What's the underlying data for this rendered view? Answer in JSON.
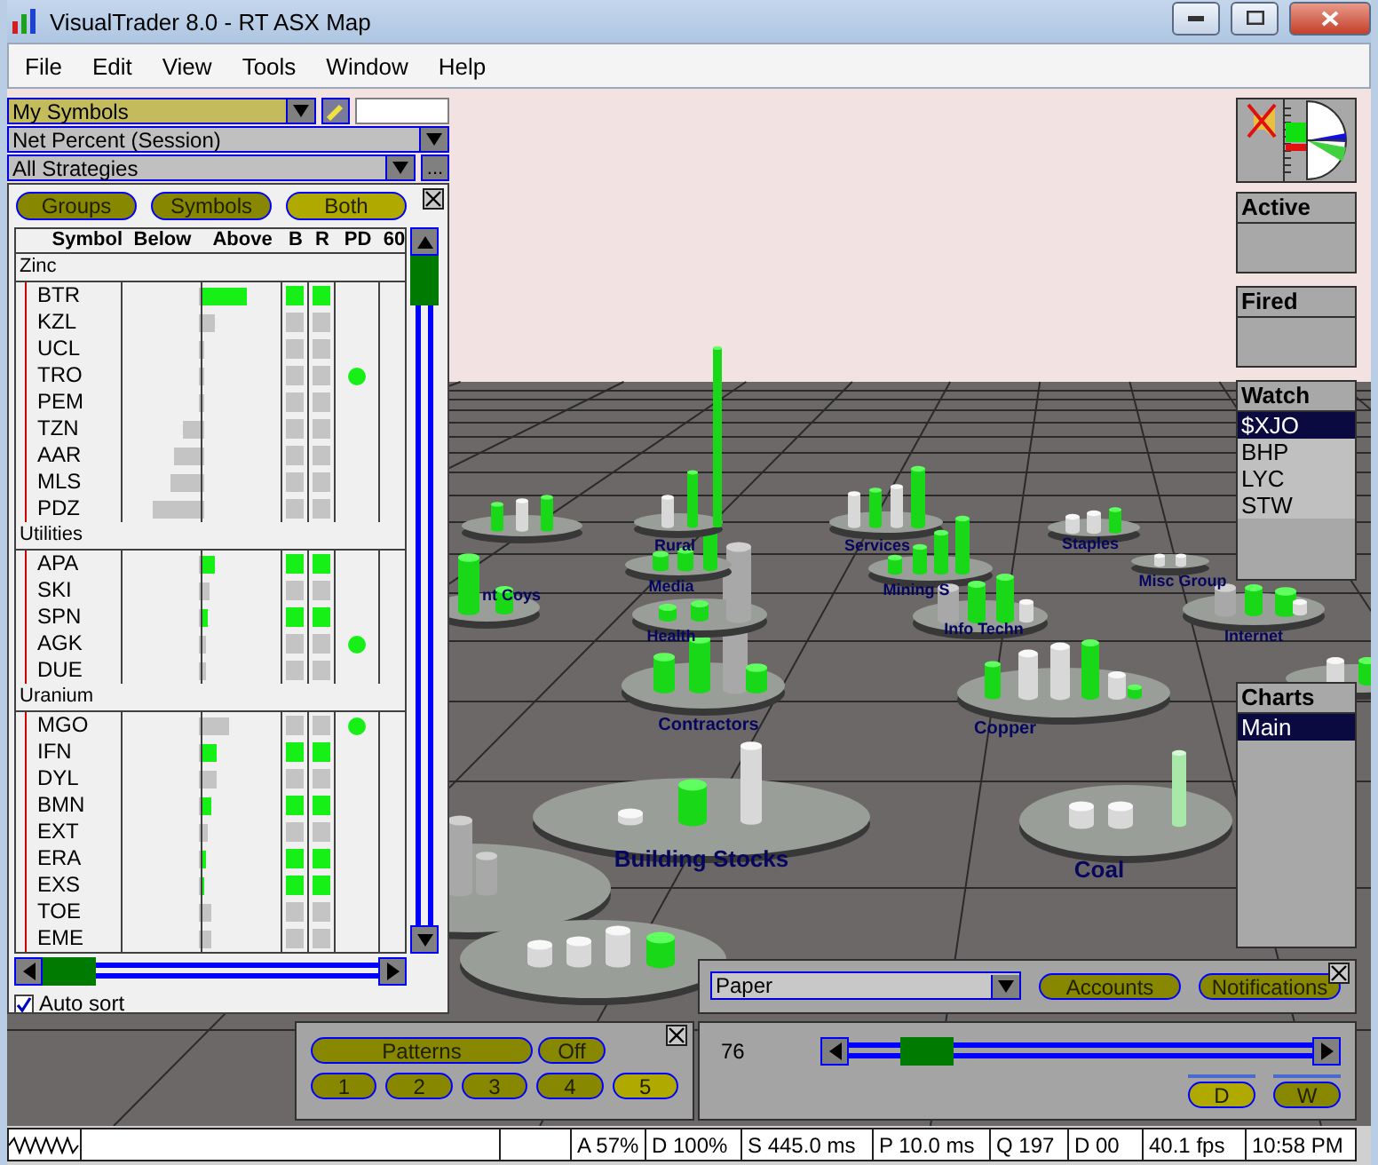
{
  "window": {
    "title": "VisualTrader 8.0 - RT ASX Map"
  },
  "menu": [
    "File",
    "Edit",
    "View",
    "Tools",
    "Window",
    "Help"
  ],
  "selectors": [
    {
      "kind": "list",
      "value": "My Symbols"
    },
    {
      "kind": "plain",
      "value": "Net Percent (Session)"
    },
    {
      "kind": "more",
      "value": "All Strategies",
      "more": "..."
    }
  ],
  "view_buttons": [
    {
      "label": "Groups",
      "selected": false
    },
    {
      "label": "Symbols",
      "selected": false
    },
    {
      "label": "Both",
      "selected": true
    }
  ],
  "table": {
    "columns": [
      "Symbol",
      "Below",
      "Above",
      "B",
      "R",
      "PD",
      "60"
    ],
    "groups": [
      {
        "name": "Zinc",
        "rows": [
          {
            "symbol": "BTR",
            "below": {
              "level": 0
            },
            "above": {
              "level": 0.55,
              "rising": true
            },
            "b": true,
            "r": true,
            "pd": false
          },
          {
            "symbol": "KZL",
            "below": {
              "level": 0
            },
            "above": {
              "level": 0.15,
              "rising": false
            },
            "b": false,
            "r": false,
            "pd": false
          },
          {
            "symbol": "UCL",
            "below": {
              "level": 0
            },
            "above": {
              "level": 0
            },
            "b": false,
            "r": false,
            "pd": false
          },
          {
            "symbol": "TRO",
            "below": {
              "level": 0
            },
            "above": {
              "level": 0
            },
            "b": false,
            "r": false,
            "pd": true
          },
          {
            "symbol": "PEM",
            "below": {
              "level": 0
            },
            "above": {
              "level": 0
            },
            "b": false,
            "r": false,
            "pd": false
          },
          {
            "symbol": "TZN",
            "below": {
              "level": 0.22
            },
            "above": {
              "level": 0
            },
            "b": false,
            "r": false,
            "pd": false
          },
          {
            "symbol": "AAR",
            "below": {
              "level": 0.33
            },
            "above": {
              "level": 0
            },
            "b": false,
            "r": false,
            "pd": false
          },
          {
            "symbol": "MLS",
            "below": {
              "level": 0.38
            },
            "above": {
              "level": 0
            },
            "b": false,
            "r": false,
            "pd": false
          },
          {
            "symbol": "PDZ",
            "below": {
              "level": 0.6
            },
            "above": {
              "level": 0
            },
            "b": false,
            "r": false,
            "pd": false
          }
        ]
      },
      {
        "name": "Utilities",
        "rows": [
          {
            "symbol": "APA",
            "below": {
              "level": 0
            },
            "above": {
              "level": 0.15,
              "rising": true
            },
            "b": true,
            "r": true,
            "pd": false
          },
          {
            "symbol": "SKI",
            "below": {
              "level": 0
            },
            "above": {
              "level": 0.08,
              "rising": false
            },
            "b": false,
            "r": false,
            "pd": false
          },
          {
            "symbol": "SPN",
            "below": {
              "level": 0
            },
            "above": {
              "level": 0.06,
              "rising": true
            },
            "b": true,
            "r": true,
            "pd": false
          },
          {
            "symbol": "AGK",
            "below": {
              "level": 0
            },
            "above": {
              "level": 0.05,
              "rising": false
            },
            "b": false,
            "r": false,
            "pd": true
          },
          {
            "symbol": "DUE",
            "below": {
              "level": 0
            },
            "above": {
              "level": 0.05,
              "rising": false
            },
            "b": false,
            "r": false,
            "pd": false
          }
        ]
      },
      {
        "name": "Uranium",
        "rows": [
          {
            "symbol": "MGO",
            "below": {
              "level": 0
            },
            "above": {
              "level": 0.33,
              "rising": false
            },
            "b": false,
            "r": false,
            "pd": true
          },
          {
            "symbol": "IFN",
            "below": {
              "level": 0
            },
            "above": {
              "level": 0.17,
              "rising": true
            },
            "b": true,
            "r": true,
            "pd": false
          },
          {
            "symbol": "DYL",
            "below": {
              "level": 0
            },
            "above": {
              "level": 0.17,
              "rising": false
            },
            "b": false,
            "r": false,
            "pd": false
          },
          {
            "symbol": "BMN",
            "below": {
              "level": 0
            },
            "above": {
              "level": 0.12,
              "rising": true
            },
            "b": true,
            "r": true,
            "pd": false
          },
          {
            "symbol": "EXT",
            "below": {
              "level": 0
            },
            "above": {
              "level": 0.07,
              "rising": false
            },
            "b": false,
            "r": false,
            "pd": false
          },
          {
            "symbol": "ERA",
            "below": {
              "level": 0
            },
            "above": {
              "level": 0.05,
              "rising": true
            },
            "b": true,
            "r": true,
            "pd": false
          },
          {
            "symbol": "EXS",
            "below": {
              "level": 0
            },
            "above": {
              "level": 0.03,
              "rising": true
            },
            "b": true,
            "r": true,
            "pd": false
          },
          {
            "symbol": "TOE",
            "below": {
              "level": 0
            },
            "above": {
              "level": 0.1,
              "rising": false
            },
            "b": false,
            "r": false,
            "pd": false
          },
          {
            "symbol": "EME",
            "below": {
              "level": 0
            },
            "above": {
              "level": 0.1,
              "rising": false
            },
            "b": false,
            "r": false,
            "pd": false
          }
        ]
      }
    ]
  },
  "auto_sort": {
    "label": "Auto sort",
    "checked": true
  },
  "side_panels": [
    {
      "title": "Active"
    },
    {
      "title": "Fired"
    },
    {
      "title": "Watch",
      "items": [
        {
          "label": "$XJO",
          "selected": true
        },
        {
          "label": "BHP",
          "selected": false
        },
        {
          "label": "LYC",
          "selected": false
        },
        {
          "label": "STW",
          "selected": false
        }
      ]
    },
    {
      "title": "Charts",
      "items": [
        {
          "label": "Main",
          "selected": true
        }
      ]
    }
  ],
  "scene_labels": [
    {
      "text": "Rural",
      "kind": "small"
    },
    {
      "text": "Services",
      "kind": "small"
    },
    {
      "text": "Staples",
      "kind": "small"
    },
    {
      "text": "Media",
      "kind": "small"
    },
    {
      "text": "Mining S",
      "kind": "small"
    },
    {
      "text": "Misc Group",
      "kind": "small"
    },
    {
      "text": "nt Coys",
      "kind": "small"
    },
    {
      "text": "Health",
      "kind": "small"
    },
    {
      "text": "Info Techn",
      "kind": "small"
    },
    {
      "text": "Internet",
      "kind": "small"
    },
    {
      "text": "Contractors",
      "kind": "medium"
    },
    {
      "text": "Copper",
      "kind": "medium"
    },
    {
      "text": "Building Stocks",
      "kind": "large"
    },
    {
      "text": "Coal",
      "kind": "large"
    }
  ],
  "account_bar": {
    "account": "Paper",
    "buttons": [
      "Accounts",
      "Notifications"
    ]
  },
  "patterns": {
    "label": "Patterns",
    "toggle": "Off",
    "numbers": [
      {
        "label": "1",
        "selected": false
      },
      {
        "label": "2",
        "selected": false
      },
      {
        "label": "3",
        "selected": false
      },
      {
        "label": "4",
        "selected": false
      },
      {
        "label": "5",
        "selected": true
      }
    ]
  },
  "timeline": {
    "value": "76",
    "level": 0.17,
    "buttons": [
      {
        "label": "D",
        "selected": true
      },
      {
        "label": "W",
        "selected": false
      }
    ]
  },
  "status_bar": {
    "cells": [
      "A 57%",
      "D 100%",
      "S 445.0 ms",
      "P 10.0 ms",
      "Q 197",
      "D 00",
      "40.1 fps",
      "10:58 PM"
    ]
  }
}
